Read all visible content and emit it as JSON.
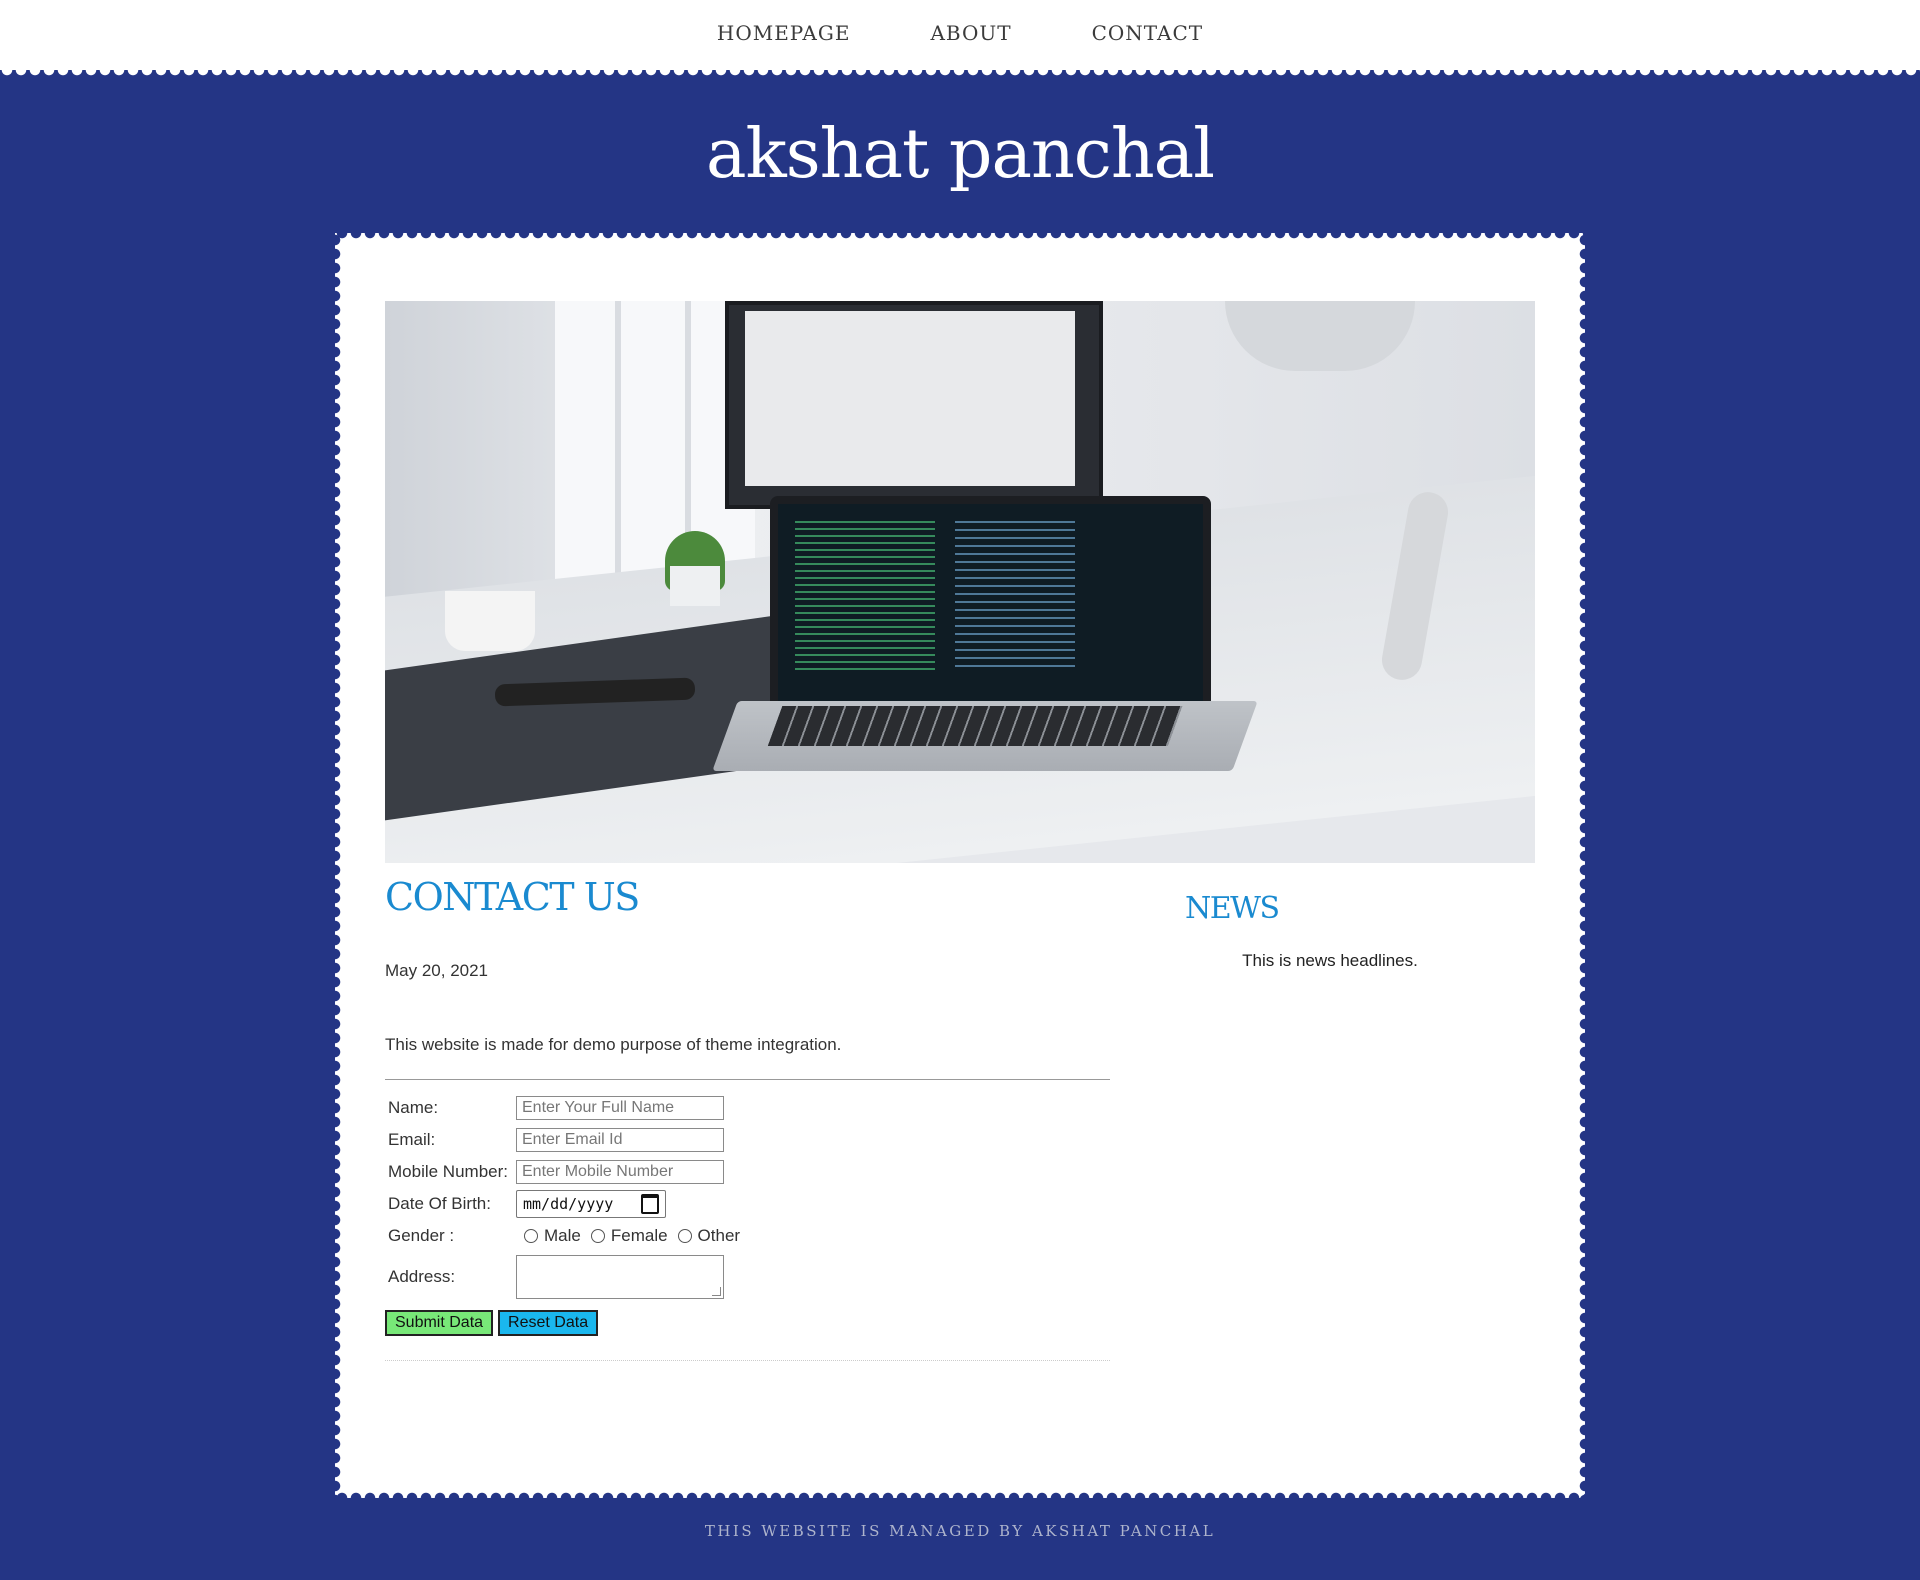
{
  "nav": {
    "items": [
      {
        "label": "HOMEPAGE"
      },
      {
        "label": "ABOUT"
      },
      {
        "label": "CONTACT"
      }
    ]
  },
  "site": {
    "title": "akshat panchal"
  },
  "post": {
    "heading": "CONTACT US",
    "date": "May 20, 2021",
    "text": "This website is made for demo purpose of theme integration."
  },
  "form": {
    "name_label": "Name:",
    "name_placeholder": "Enter Your Full Name",
    "email_label": "Email:",
    "email_placeholder": "Enter Email Id",
    "mobile_label": "Mobile Number:",
    "mobile_placeholder": "Enter Mobile Number",
    "dob_label": "Date Of Birth:",
    "dob_placeholder": "mm/dd/yyyy",
    "gender_label": "Gender :",
    "gender_options": [
      "Male",
      "Female",
      "Other"
    ],
    "address_label": "Address:",
    "submit_label": "Submit Data",
    "reset_label": "Reset Data"
  },
  "sidebar": {
    "heading": "NEWS",
    "news_text": "This is news headlines."
  },
  "footer": {
    "text": "THIS WEBSITE IS MANAGED BY AKSHAT PANCHAL"
  },
  "colors": {
    "background": "#243585",
    "accent": "#1a8ad0",
    "submit": "#78e878",
    "reset": "#1ab7ee"
  }
}
